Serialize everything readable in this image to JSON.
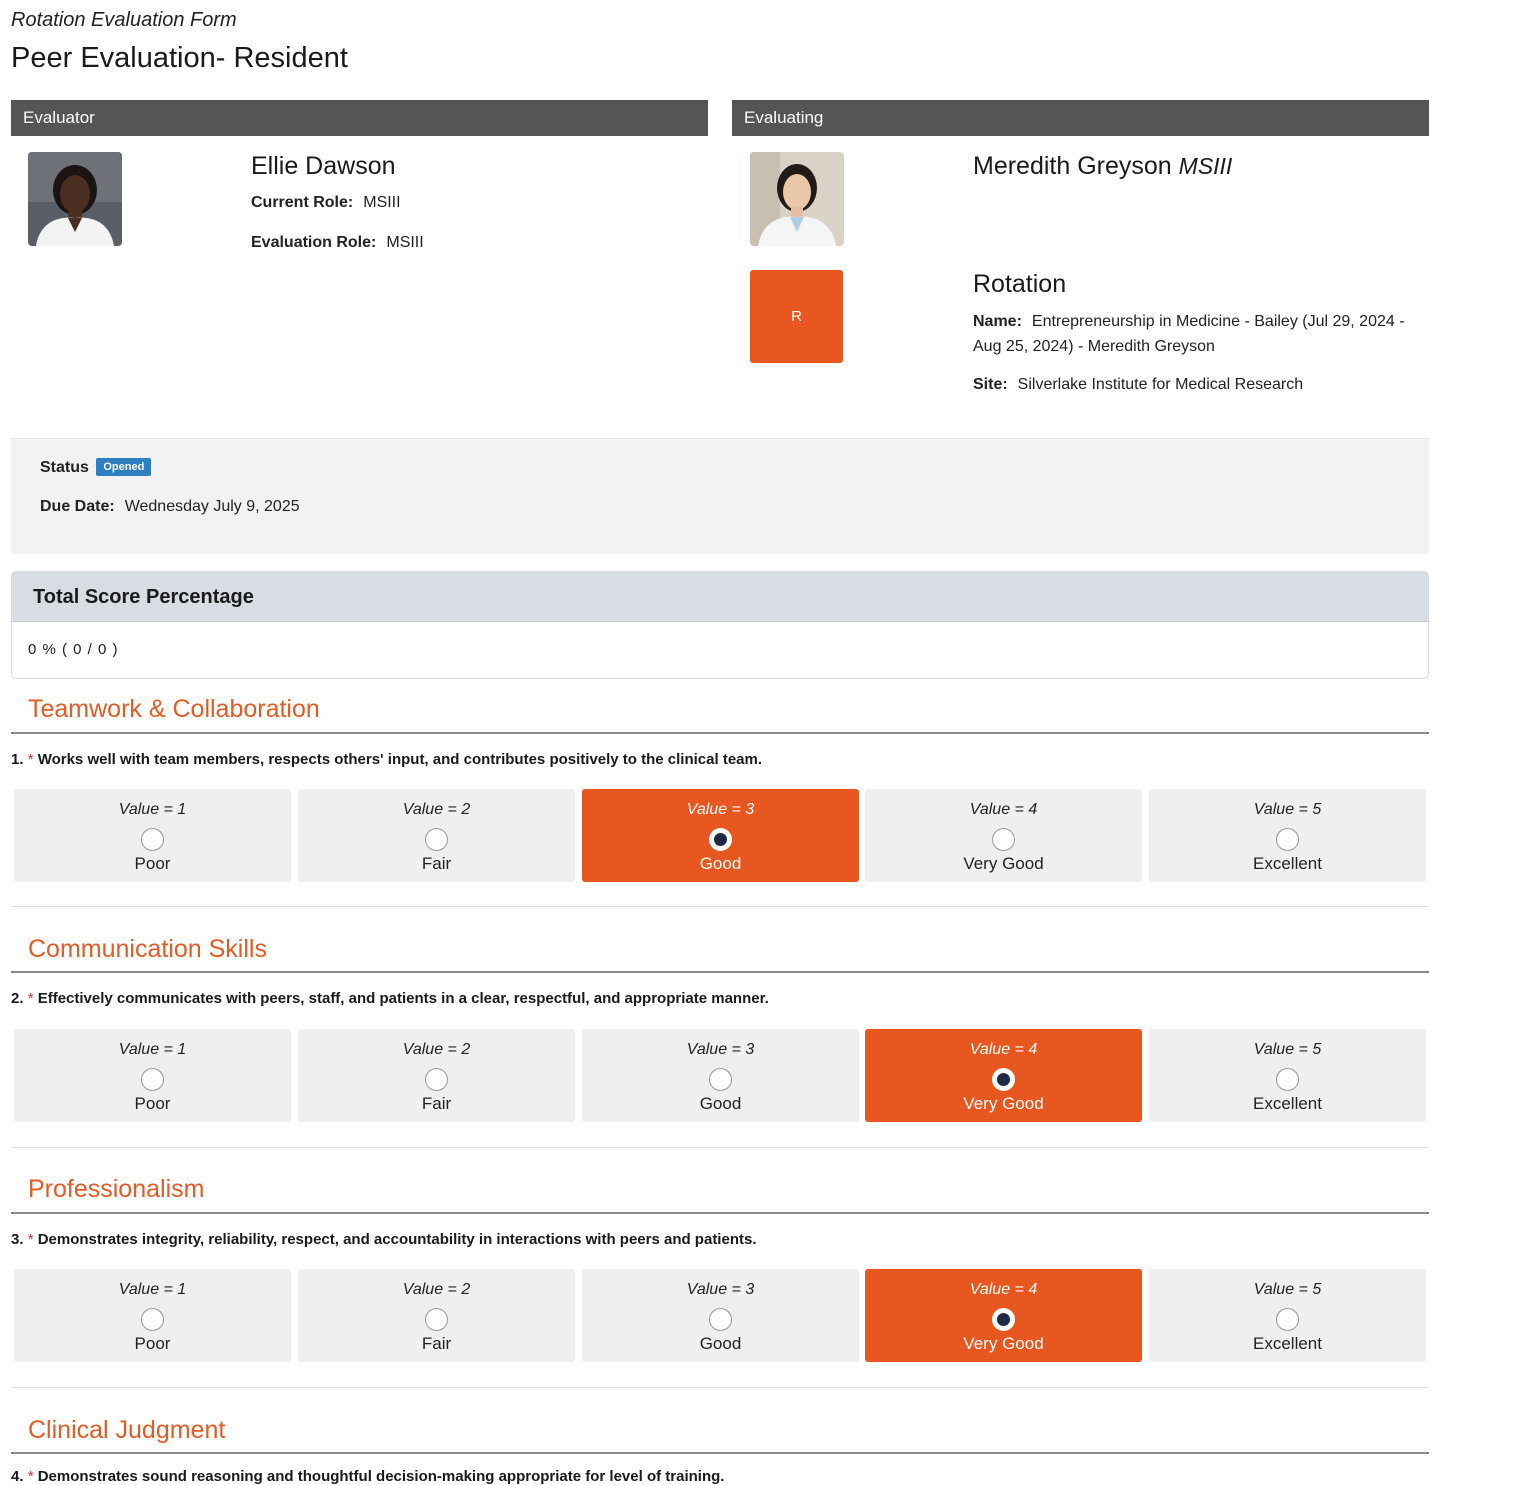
{
  "header": {
    "form_type": "Rotation Evaluation Form",
    "title": "Peer Evaluation- Resident"
  },
  "evaluator": {
    "heading": "Evaluator",
    "name": "Ellie Dawson",
    "current_role_label": "Current Role:",
    "current_role": "MSIII",
    "evaluation_role_label": "Evaluation Role:",
    "evaluation_role": "MSIII"
  },
  "evaluating": {
    "heading": "Evaluating",
    "name": "Meredith Greyson",
    "suffix": "MSIII"
  },
  "rotation": {
    "tile_letter": "R",
    "title": "Rotation",
    "name_label": "Name:",
    "name": "Entrepreneurship in Medicine - Bailey (Jul 29, 2024 - Aug 25, 2024) - Meredith Greyson",
    "site_label": "Site:",
    "site": "Silverlake Institute for Medical Research"
  },
  "status": {
    "label": "Status",
    "badge": "Opened",
    "due_label": "Due Date:",
    "due_date": "Wednesday July 9, 2025"
  },
  "score": {
    "title": "Total Score Percentage",
    "value": "0 % ( 0 / 0 )"
  },
  "colors": {
    "accent": "#e8571f",
    "section_title": "#e35b25",
    "badge": "#2d7fc1",
    "panel_header": "#555555"
  },
  "scale": [
    {
      "value": "Value = 1",
      "label": "Poor"
    },
    {
      "value": "Value = 2",
      "label": "Fair"
    },
    {
      "value": "Value = 3",
      "label": "Good"
    },
    {
      "value": "Value = 4",
      "label": "Very Good"
    },
    {
      "value": "Value = 5",
      "label": "Excellent"
    }
  ],
  "sections": [
    {
      "title": "Teamwork & Collaboration",
      "number": "1.",
      "required": "*",
      "question": "Works well with team members, respects others' input, and contributes positively to the clinical team.",
      "selected": 3
    },
    {
      "title": "Communication Skills",
      "number": "2.",
      "required": "*",
      "question": "Effectively communicates with peers, staff, and patients in a clear, respectful, and appropriate manner.",
      "selected": 4
    },
    {
      "title": "Professionalism",
      "number": "3.",
      "required": "*",
      "question": "Demonstrates integrity, reliability, respect, and accountability in interactions with peers and patients.",
      "selected": 4
    },
    {
      "title": "Clinical Judgment",
      "number": "4.",
      "required": "*",
      "question": "Demonstrates sound reasoning and thoughtful decision-making appropriate for level of training."
    }
  ]
}
